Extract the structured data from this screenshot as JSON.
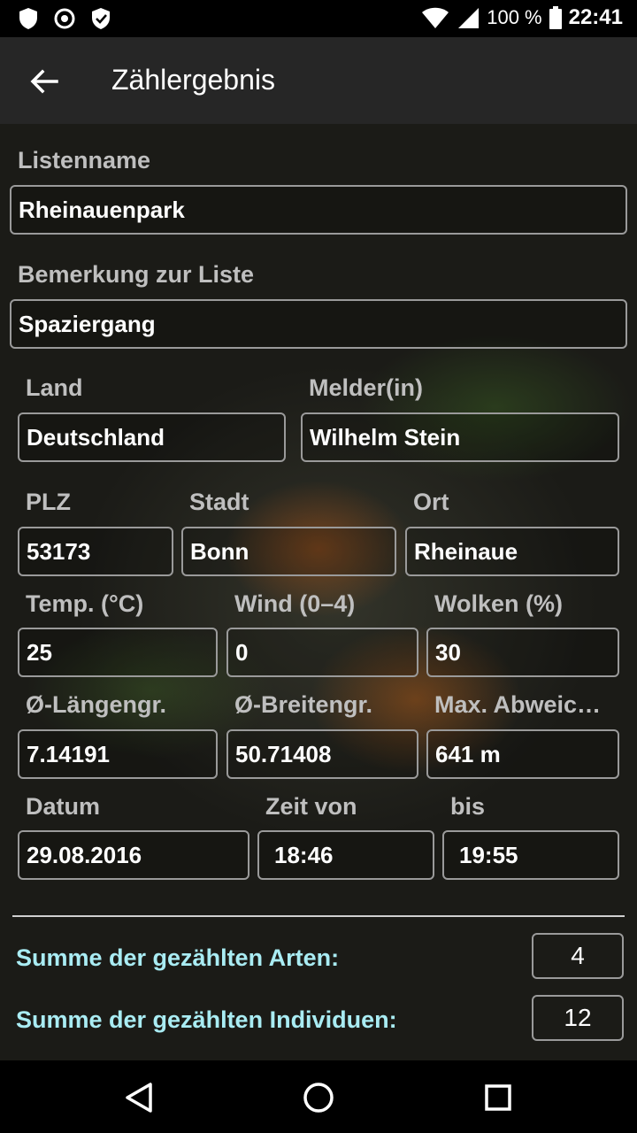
{
  "status": {
    "battery": "100 %",
    "time": "22:41",
    "icons": [
      "shield-icon",
      "circle-dot-icon",
      "shield-check-icon",
      "wifi-icon",
      "signal-icon",
      "battery-icon"
    ]
  },
  "appbar": {
    "title": "Zählergebnis",
    "back_icon": "arrow-back-icon"
  },
  "form": {
    "listname_label": "Listenname",
    "listname_value": "Rheinauenpark",
    "remark_label": "Bemerkung zur Liste",
    "remark_value": "Spaziergang",
    "country_label": "Land",
    "country_value": "Deutschland",
    "reporter_label": "Melder(in)",
    "reporter_value": "Wilhelm Stein",
    "zip_label": "PLZ",
    "zip_value": "53173",
    "city_label": "Stadt",
    "city_value": "Bonn",
    "place_label": "Ort",
    "place_value": "Rheinaue",
    "temp_label": "Temp. (°C)",
    "temp_value": "25",
    "wind_label": "Wind (0–4)",
    "wind_value": "0",
    "clouds_label": "Wolken (%)",
    "clouds_value": "30",
    "lon_label": "Ø-Längengr.",
    "lon_value": "7.14191",
    "lat_label": "Ø-Breitengr.",
    "lat_value": "50.71408",
    "maxdev_label": "Max. Abweic…",
    "maxdev_value": "641 m",
    "date_label": "Datum",
    "date_value": "29.08.2016",
    "from_label": "Zeit von",
    "from_value": "18:46",
    "to_label": "bis",
    "to_value": "19:55"
  },
  "summary": {
    "species_label": "Summe der gezählten Arten:",
    "species_value": "4",
    "individuals_label": "Summe der gezählten Individuen:",
    "individuals_value": "12"
  },
  "navbar": {
    "icons": [
      "back-triangle-icon",
      "home-circle-icon",
      "recents-square-icon"
    ]
  },
  "colors": {
    "accent_label": "#a9ecf3",
    "appbar": "#262626",
    "field_border": "#9a9a9a"
  }
}
